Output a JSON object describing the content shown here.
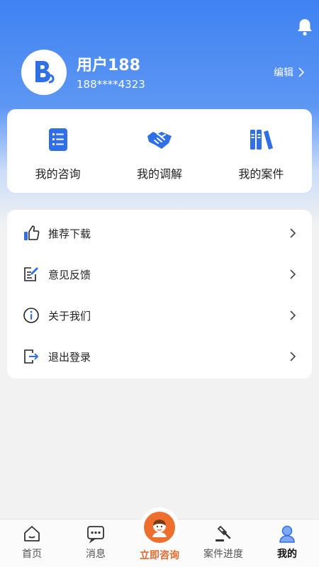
{
  "header": {
    "username": "用户188",
    "phone": "188****4323",
    "edit_label": "编辑"
  },
  "quick_actions": [
    {
      "label": "我的咨询",
      "icon": "document-list-icon"
    },
    {
      "label": "我的调解",
      "icon": "handshake-icon"
    },
    {
      "label": "我的案件",
      "icon": "books-icon"
    }
  ],
  "menu": [
    {
      "label": "推荐下载",
      "icon": "thumbs-up-icon"
    },
    {
      "label": "意见反馈",
      "icon": "feedback-edit-icon"
    },
    {
      "label": "关于我们",
      "icon": "info-icon"
    },
    {
      "label": "退出登录",
      "icon": "logout-icon"
    }
  ],
  "tabbar": [
    {
      "label": "首页",
      "icon": "home-icon"
    },
    {
      "label": "消息",
      "icon": "message-icon"
    },
    {
      "label": "立即咨询",
      "icon": "consultant-icon"
    },
    {
      "label": "案件进度",
      "icon": "gavel-icon"
    },
    {
      "label": "我的",
      "icon": "profile-icon"
    }
  ],
  "colors": {
    "brand_blue": "#3f82f2",
    "accent_orange": "#ee6f2d"
  }
}
